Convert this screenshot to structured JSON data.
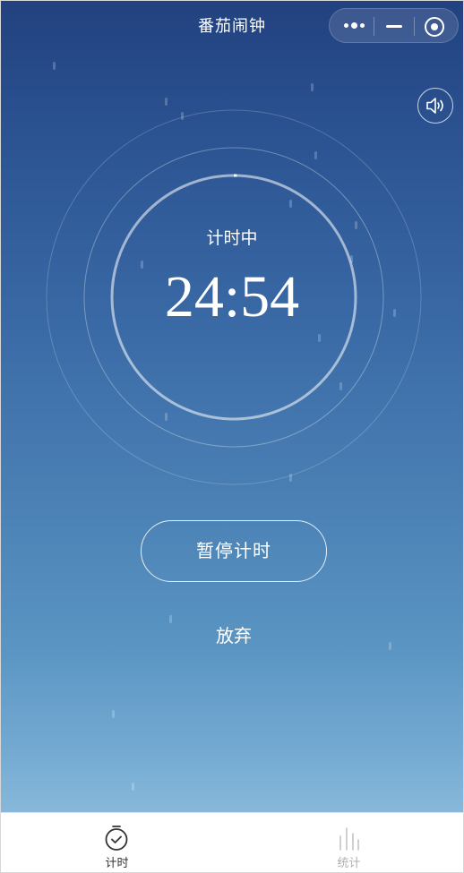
{
  "header": {
    "title": "番茄闹钟"
  },
  "capsule": {
    "more_icon": "more-dots-icon",
    "minimize_icon": "minimize-icon",
    "close_icon": "target-close-icon"
  },
  "sound": {
    "icon": "speaker-icon"
  },
  "timer": {
    "status": "计时中",
    "remaining": "24:54",
    "progress": 0.004
  },
  "actions": {
    "pause_label": "暂停计时",
    "abandon_label": "放弃"
  },
  "tabbar": {
    "tabs": [
      {
        "label": "计时",
        "icon": "stopwatch-icon",
        "active": true
      },
      {
        "label": "统计",
        "icon": "bar-chart-icon",
        "active": false
      }
    ]
  },
  "colors": {
    "sky_top": "#22417f",
    "sky_bottom": "#6aa5cf",
    "active_tab": "#333333",
    "inactive_tab": "#b0b0b0"
  }
}
